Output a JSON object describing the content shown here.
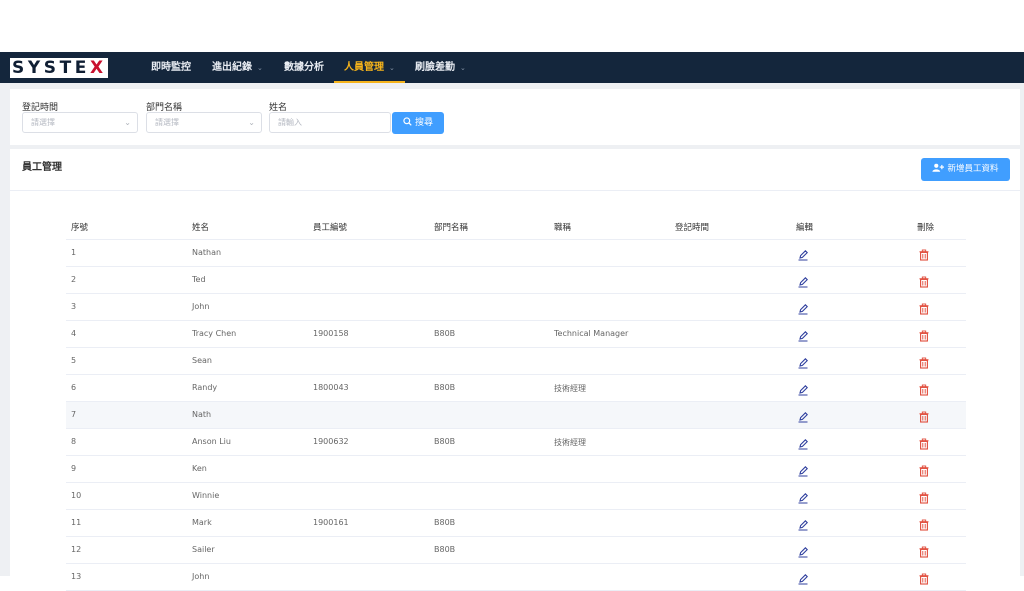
{
  "brand": {
    "logo_main": "SYSTE",
    "logo_accent": "X"
  },
  "nav": {
    "items": [
      {
        "label": "即時監控",
        "has_dropdown": false,
        "active": false
      },
      {
        "label": "進出紀錄",
        "has_dropdown": true,
        "active": false
      },
      {
        "label": "數據分析",
        "has_dropdown": false,
        "active": false
      },
      {
        "label": "人員管理",
        "has_dropdown": true,
        "active": true
      },
      {
        "label": "刷臉差勤",
        "has_dropdown": true,
        "active": false
      }
    ],
    "active_color": "#f5b31b",
    "bar_color": "#14263c"
  },
  "filters": {
    "date_label": "登記時間",
    "date_placeholder": "請選擇",
    "dept_label": "部門名稱",
    "dept_placeholder": "請選擇",
    "name_label": "姓名",
    "name_placeholder": "請輸入",
    "search_button": "搜尋"
  },
  "panel": {
    "title": "員工管理",
    "add_button": "新增員工資料"
  },
  "table": {
    "columns": [
      "序號",
      "姓名",
      "員工編號",
      "部門名稱",
      "職稱",
      "登記時間",
      "編輯",
      "刪除"
    ],
    "rows": [
      {
        "no": "1",
        "name": "Nathan",
        "emp_id": "",
        "dept": "",
        "title": "",
        "reg_time": ""
      },
      {
        "no": "2",
        "name": "Ted",
        "emp_id": "",
        "dept": "",
        "title": "",
        "reg_time": ""
      },
      {
        "no": "3",
        "name": "John",
        "emp_id": "",
        "dept": "",
        "title": "",
        "reg_time": ""
      },
      {
        "no": "4",
        "name": "Tracy Chen",
        "emp_id": "1900158",
        "dept": "B80B",
        "title": "Technical Manager",
        "reg_time": ""
      },
      {
        "no": "5",
        "name": "Sean",
        "emp_id": "",
        "dept": "",
        "title": "",
        "reg_time": ""
      },
      {
        "no": "6",
        "name": "Randy",
        "emp_id": "1800043",
        "dept": "B80B",
        "title": "技術經理",
        "reg_time": ""
      },
      {
        "no": "7",
        "name": "Nath",
        "emp_id": "",
        "dept": "",
        "title": "",
        "reg_time": ""
      },
      {
        "no": "8",
        "name": "Anson Liu",
        "emp_id": "1900632",
        "dept": "B80B",
        "title": "技術經理",
        "reg_time": ""
      },
      {
        "no": "9",
        "name": "Ken",
        "emp_id": "",
        "dept": "",
        "title": "",
        "reg_time": ""
      },
      {
        "no": "10",
        "name": "Winnie",
        "emp_id": "",
        "dept": "",
        "title": "",
        "reg_time": ""
      },
      {
        "no": "11",
        "name": "Mark",
        "emp_id": "1900161",
        "dept": "B80B",
        "title": "",
        "reg_time": ""
      },
      {
        "no": "12",
        "name": "Sailer",
        "emp_id": "",
        "dept": "B80B",
        "title": "",
        "reg_time": ""
      },
      {
        "no": "13",
        "name": "John",
        "emp_id": "",
        "dept": "",
        "title": "",
        "reg_time": ""
      }
    ],
    "highlighted_row": 7,
    "edit_icon": "pencil-icon",
    "delete_icon": "trash-icon",
    "edit_color": "#2f3f9e",
    "delete_color": "#e04b3a"
  }
}
